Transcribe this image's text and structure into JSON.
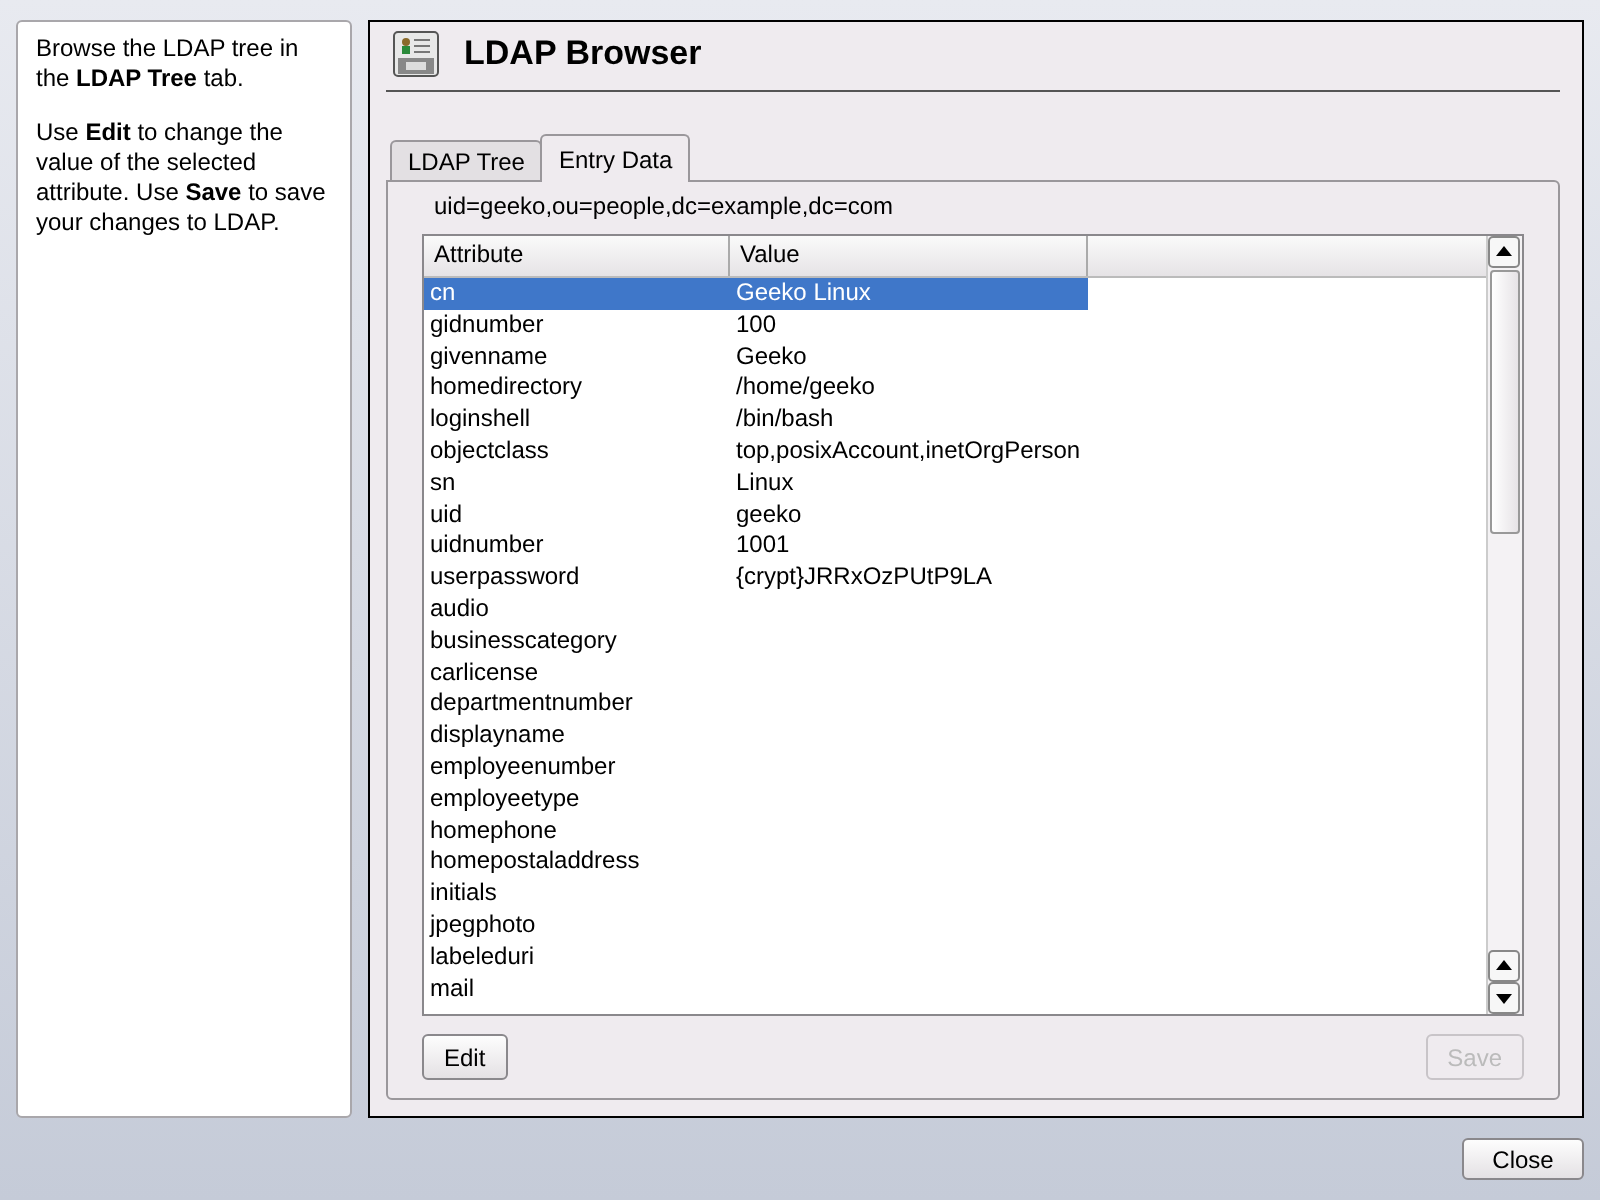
{
  "help": [
    "Browse the LDAP tree in the **LDAP Tree** tab.",
    "Use **Edit** to change the value of the selected attribute. Use **Save** to save your changes to LDAP."
  ],
  "window": {
    "title": "LDAP Browser"
  },
  "tabs": [
    {
      "label": "LDAP Tree",
      "selected": false
    },
    {
      "label": "Entry Data",
      "selected": true
    }
  ],
  "dn": "uid=geeko,ou=people,dc=example,dc=com",
  "table": {
    "columns": [
      "Attribute",
      "Value"
    ],
    "rows": [
      {
        "attribute": "cn",
        "value": "Geeko Linux",
        "selected": true
      },
      {
        "attribute": "gidnumber",
        "value": "100",
        "selected": false
      },
      {
        "attribute": "givenname",
        "value": "Geeko",
        "selected": false
      },
      {
        "attribute": "homedirectory",
        "value": "/home/geeko",
        "selected": false
      },
      {
        "attribute": "loginshell",
        "value": "/bin/bash",
        "selected": false
      },
      {
        "attribute": "objectclass",
        "value": "top,posixAccount,inetOrgPerson",
        "selected": false
      },
      {
        "attribute": "sn",
        "value": "Linux",
        "selected": false
      },
      {
        "attribute": "uid",
        "value": "geeko",
        "selected": false
      },
      {
        "attribute": "uidnumber",
        "value": "1001",
        "selected": false
      },
      {
        "attribute": "userpassword",
        "value": "{crypt}JRRxOzPUtP9LA",
        "selected": false
      },
      {
        "attribute": "audio",
        "selected": false
      },
      {
        "attribute": "businesscategory",
        "selected": false
      },
      {
        "attribute": "carlicense",
        "selected": false
      },
      {
        "attribute": "departmentnumber",
        "selected": false
      },
      {
        "attribute": "displayname",
        "selected": false
      },
      {
        "attribute": "employeenumber",
        "selected": false
      },
      {
        "attribute": "employeetype",
        "selected": false
      },
      {
        "attribute": "homephone",
        "selected": false
      },
      {
        "attribute": "homepostaladdress",
        "selected": false
      },
      {
        "attribute": "initials",
        "selected": false
      },
      {
        "attribute": "jpegphoto",
        "selected": false
      },
      {
        "attribute": "labeleduri",
        "selected": false
      },
      {
        "attribute": "mail",
        "selected": false
      }
    ]
  },
  "buttons": [
    {
      "label": "Edit",
      "disabled": false
    },
    {
      "label": "Save",
      "disabled": true
    }
  ],
  "close_button": {
    "label": "Close"
  }
}
